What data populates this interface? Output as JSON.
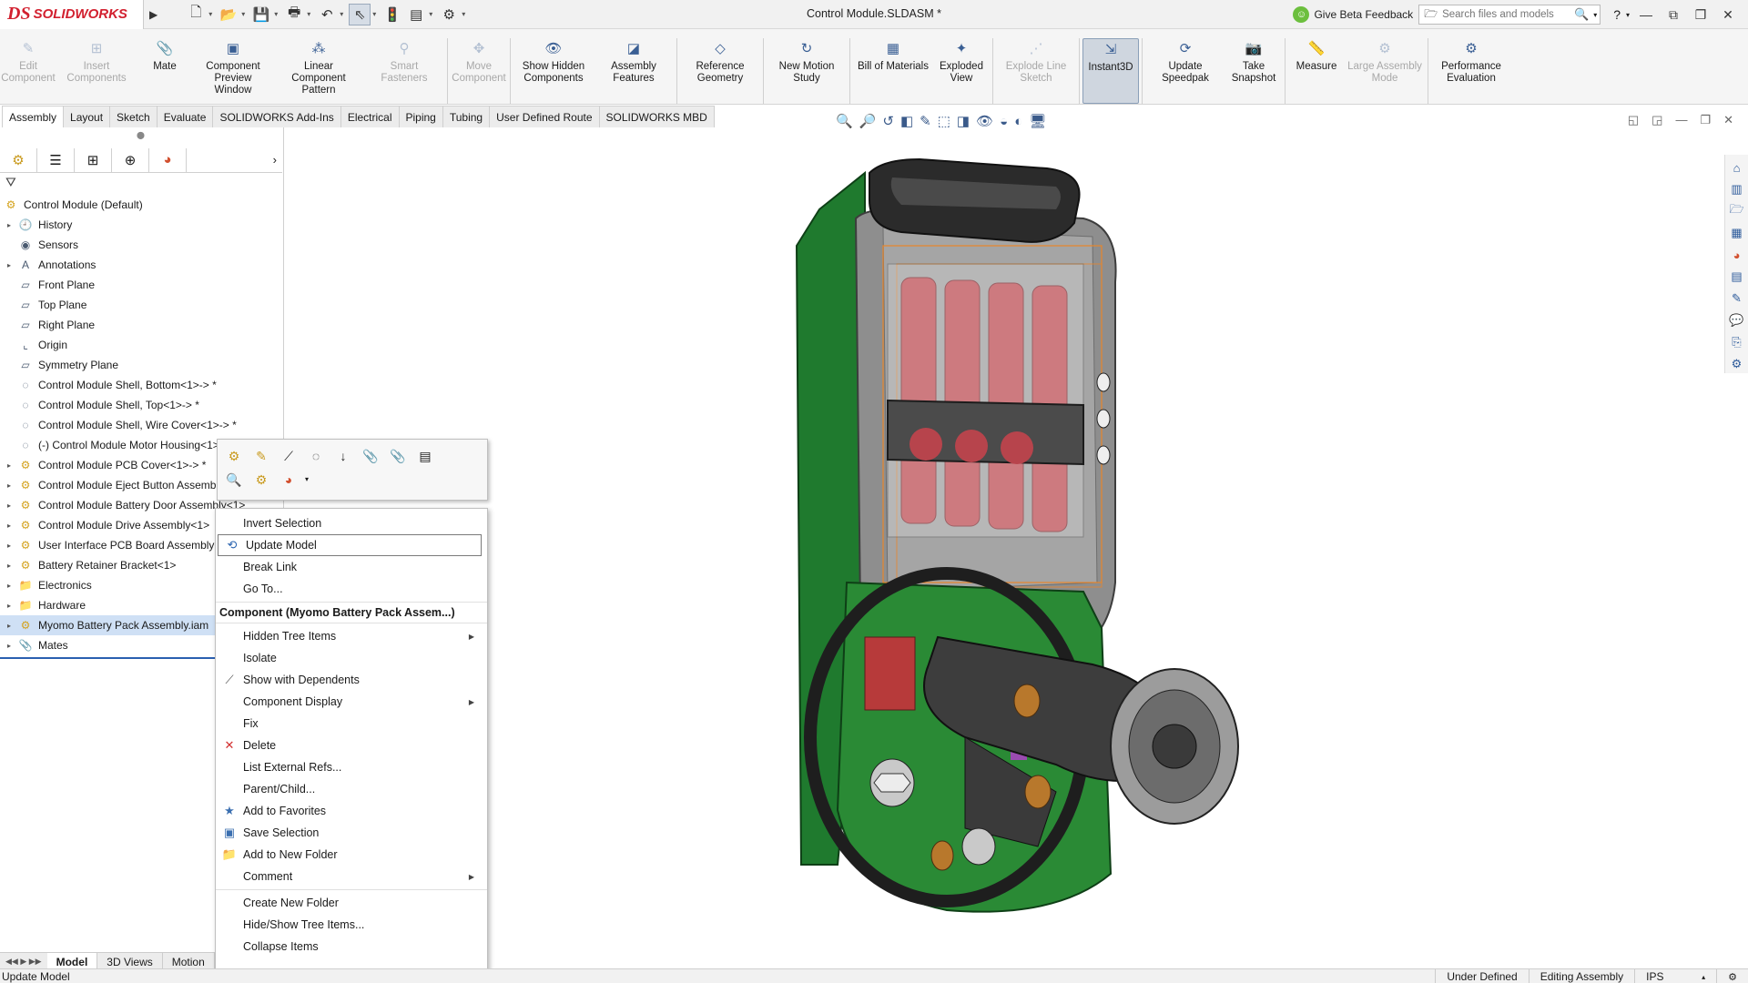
{
  "app": {
    "brand_ds": "DS",
    "brand_name": "SOLIDWORKS",
    "document_title": "Control Module.SLDASM *"
  },
  "titlebar": {
    "feedback": "Give Beta Feedback",
    "search_placeholder": "Search files and models",
    "help": "?"
  },
  "ribbon": [
    {
      "label": "Edit Component",
      "disabled": true,
      "icon": "edit-component-icon"
    },
    {
      "label": "Insert Components",
      "disabled": true,
      "icon": "insert-components-icon"
    },
    {
      "label": "Mate",
      "icon": "mate-icon"
    },
    {
      "label": "Component Preview Window",
      "icon": "component-preview-icon"
    },
    {
      "label": "Linear Component Pattern",
      "icon": "linear-pattern-icon"
    },
    {
      "label": "Smart Fasteners",
      "disabled": true,
      "icon": "smart-fasteners-icon"
    },
    {
      "label": "Move Component",
      "disabled": true,
      "icon": "move-component-icon"
    },
    {
      "label": "Show Hidden Components",
      "icon": "show-hidden-icon"
    },
    {
      "label": "Assembly Features",
      "icon": "assembly-features-icon"
    },
    {
      "label": "Reference Geometry",
      "icon": "reference-geometry-icon"
    },
    {
      "label": "New Motion Study",
      "icon": "motion-study-icon"
    },
    {
      "label": "Bill of Materials",
      "icon": "bom-icon"
    },
    {
      "label": "Exploded View",
      "icon": "exploded-view-icon"
    },
    {
      "label": "Explode Line Sketch",
      "disabled": true,
      "icon": "explode-line-icon"
    },
    {
      "label": "Instant3D",
      "active": true,
      "icon": "instant3d-icon"
    },
    {
      "label": "Update Speedpak",
      "icon": "speedpak-icon"
    },
    {
      "label": "Take Snapshot",
      "icon": "snapshot-icon"
    },
    {
      "label": "Measure",
      "icon": "measure-icon"
    },
    {
      "label": "Large Assembly Mode",
      "disabled": true,
      "icon": "large-assembly-icon"
    },
    {
      "label": "Performance Evaluation",
      "icon": "performance-icon"
    }
  ],
  "command_tabs": [
    "Assembly",
    "Layout",
    "Sketch",
    "Evaluate",
    "SOLIDWORKS Add-Ins",
    "Electrical",
    "Piping",
    "Tubing",
    "User Defined Route",
    "SOLIDWORKS MBD"
  ],
  "tree": {
    "root": "Control Module  (Default)",
    "items": [
      {
        "label": "History",
        "exp": true,
        "icon": "history-icon"
      },
      {
        "label": "Sensors",
        "icon": "sensors-icon"
      },
      {
        "label": "Annotations",
        "exp": true,
        "icon": "annotations-icon"
      },
      {
        "label": "Front Plane",
        "icon": "plane-icon"
      },
      {
        "label": "Top Plane",
        "icon": "plane-icon"
      },
      {
        "label": "Right Plane",
        "icon": "plane-icon"
      },
      {
        "label": "Origin",
        "icon": "origin-icon"
      },
      {
        "label": "Symmetry Plane",
        "icon": "plane-icon"
      },
      {
        "label": "Control Module Shell, Bottom<1>-> *",
        "icon": "part-icon"
      },
      {
        "label": "Control Module Shell, Top<1>-> *",
        "icon": "part-icon"
      },
      {
        "label": "Control Module Shell, Wire Cover<1>-> *",
        "icon": "part-icon"
      },
      {
        "label": "(-) Control Module Motor Housing<1>",
        "icon": "part-icon"
      },
      {
        "label": "Control Module PCB Cover<1>-> *",
        "exp": true,
        "icon": "assembly-icon"
      },
      {
        "label": "Control Module Eject Button Assembly<1>",
        "exp": true,
        "icon": "assembly-icon"
      },
      {
        "label": "Control Module Battery Door Assembly<1>",
        "exp": true,
        "icon": "assembly-icon"
      },
      {
        "label": "Control Module Drive Assembly<1>",
        "exp": true,
        "icon": "assembly-icon"
      },
      {
        "label": "User Interface PCB Board Assembly<1>",
        "exp": true,
        "icon": "assembly-icon"
      },
      {
        "label": "Battery Retainer Bracket<1>",
        "exp": true,
        "icon": "assembly-icon"
      },
      {
        "label": "Electronics",
        "exp": true,
        "icon": "folder-icon"
      },
      {
        "label": "Hardware",
        "exp": true,
        "icon": "folder-icon"
      },
      {
        "label": "Myomo Battery Pack Assembly.iam",
        "exp": true,
        "icon": "assembly-icon",
        "selected": true
      },
      {
        "label": "Mates",
        "exp": true,
        "icon": "mates-icon"
      }
    ]
  },
  "bottom_tabs": [
    "Model",
    "3D Views",
    "Motion"
  ],
  "context_menu": {
    "top_items": [
      {
        "label": "Invert Selection",
        "icon": ""
      },
      {
        "label": "Update Model",
        "icon": "update-model-icon",
        "hover": true
      },
      {
        "label": "Break Link",
        "icon": ""
      },
      {
        "label": "Go To...",
        "icon": ""
      }
    ],
    "section_header": "Component (Myomo Battery Pack Assem...)",
    "items": [
      {
        "label": "Hidden Tree Items",
        "submenu": true
      },
      {
        "label": "Isolate"
      },
      {
        "label": "Show with Dependents",
        "icon": "show-dependents-icon"
      },
      {
        "label": "Component Display",
        "submenu": true
      },
      {
        "label": "Fix"
      },
      {
        "label": "Delete",
        "icon": "delete-icon"
      },
      {
        "label": "List External Refs..."
      },
      {
        "label": "Parent/Child..."
      },
      {
        "label": "Add to Favorites",
        "icon": "favorites-icon"
      },
      {
        "label": "Save Selection",
        "icon": "save-selection-icon"
      },
      {
        "label": "Add to New Folder",
        "icon": "folder-icon"
      },
      {
        "label": "Comment",
        "submenu": true
      }
    ],
    "footer_items": [
      {
        "label": "Create New Folder"
      },
      {
        "label": "Hide/Show Tree Items..."
      },
      {
        "label": "Collapse Items"
      }
    ]
  },
  "statusbar": {
    "left": "Update Model",
    "state": "Under Defined",
    "mode": "Editing Assembly",
    "units": "IPS"
  },
  "colors": {
    "brand": "#d2202f",
    "selection": "#cfe0f5",
    "pcb_green": "#1f7a2e",
    "battery_red": "#c8474f"
  }
}
